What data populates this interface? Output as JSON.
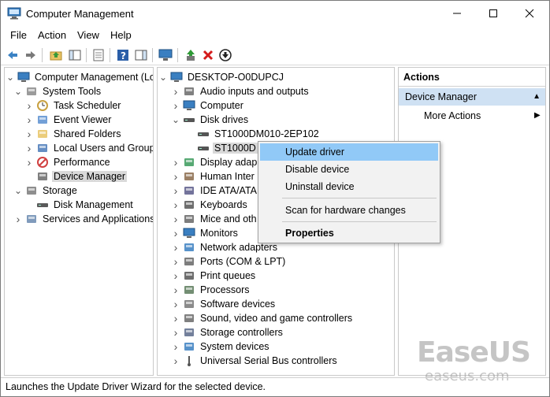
{
  "window": {
    "title": "Computer Management"
  },
  "menu": [
    "File",
    "Action",
    "View",
    "Help"
  ],
  "left_tree": [
    {
      "label": "Computer Management (Local",
      "arrow": "down",
      "icon": "computer-management-icon"
    },
    {
      "label": "System Tools",
      "arrow": "down",
      "icon": "tools-icon"
    },
    {
      "label": "Task Scheduler",
      "arrow": "right",
      "icon": "clock-icon"
    },
    {
      "label": "Event Viewer",
      "arrow": "right",
      "icon": "event-viewer-icon"
    },
    {
      "label": "Shared Folders",
      "arrow": "right",
      "icon": "shared-folder-icon"
    },
    {
      "label": "Local Users and Groups",
      "arrow": "right",
      "icon": "users-icon"
    },
    {
      "label": "Performance",
      "arrow": "right",
      "icon": "performance-icon"
    },
    {
      "label": "Device Manager",
      "arrow": "",
      "icon": "device-manager-icon",
      "selected": true
    },
    {
      "label": "Storage",
      "arrow": "down",
      "icon": "storage-icon"
    },
    {
      "label": "Disk Management",
      "arrow": "",
      "icon": "disk-icon"
    },
    {
      "label": "Services and Applications",
      "arrow": "right",
      "icon": "services-icon"
    }
  ],
  "device_tree": [
    {
      "label": "DESKTOP-O0DUPCJ",
      "arrow": "down",
      "icon": "computer-icon"
    },
    {
      "label": "Audio inputs and outputs",
      "arrow": "right",
      "icon": "speaker-icon"
    },
    {
      "label": "Computer",
      "arrow": "right",
      "icon": "monitor-icon"
    },
    {
      "label": "Disk drives",
      "arrow": "down",
      "icon": "drive-icon"
    },
    {
      "label": "ST1000DM010-2EP102",
      "arrow": "",
      "icon": "drive-icon"
    },
    {
      "label": "ST1000D",
      "arrow": "",
      "icon": "drive-icon",
      "selected": true
    },
    {
      "label": "Display adap",
      "arrow": "right",
      "icon": "display-adapter-icon"
    },
    {
      "label": "Human Inter",
      "arrow": "right",
      "icon": "hid-icon"
    },
    {
      "label": "IDE ATA/ATA",
      "arrow": "right",
      "icon": "ide-icon"
    },
    {
      "label": "Keyboards",
      "arrow": "right",
      "icon": "keyboard-icon"
    },
    {
      "label": "Mice and oth",
      "arrow": "right",
      "icon": "mouse-icon"
    },
    {
      "label": "Monitors",
      "arrow": "right",
      "icon": "monitor-icon"
    },
    {
      "label": "Network adapters",
      "arrow": "right",
      "icon": "network-icon"
    },
    {
      "label": "Ports (COM & LPT)",
      "arrow": "right",
      "icon": "port-icon"
    },
    {
      "label": "Print queues",
      "arrow": "right",
      "icon": "printer-icon"
    },
    {
      "label": "Processors",
      "arrow": "right",
      "icon": "processor-icon"
    },
    {
      "label": "Software devices",
      "arrow": "right",
      "icon": "software-device-icon"
    },
    {
      "label": "Sound, video and game controllers",
      "arrow": "right",
      "icon": "sound-icon"
    },
    {
      "label": "Storage controllers",
      "arrow": "right",
      "icon": "storage-controller-icon"
    },
    {
      "label": "System devices",
      "arrow": "right",
      "icon": "system-device-icon"
    },
    {
      "label": "Universal Serial Bus controllers",
      "arrow": "right",
      "icon": "usb-icon"
    }
  ],
  "actions": {
    "header": "Actions",
    "group": "Device Manager",
    "item": "More Actions"
  },
  "context_menu": {
    "items": [
      "Update driver",
      "Disable device",
      "Uninstall device",
      "Scan for hardware changes",
      "Properties"
    ]
  },
  "status": "Launches the Update Driver Wizard for the selected device.",
  "watermark": {
    "main": "EaseUS",
    "sub": "easeus.com"
  }
}
